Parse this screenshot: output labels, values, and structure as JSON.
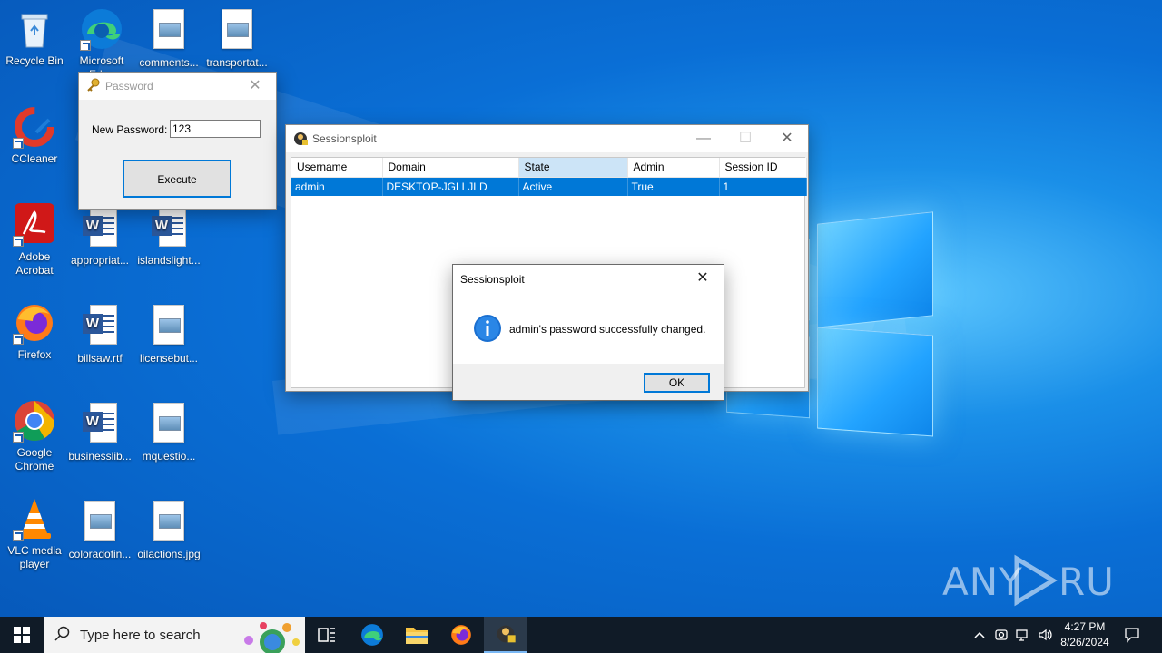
{
  "desktop": {
    "icons": [
      {
        "label": "Recycle Bin",
        "icon": "recycle-bin-icon"
      },
      {
        "label": "Microsoft Edge",
        "icon": "edge-icon"
      },
      {
        "label": "comments...",
        "icon": "image-file-icon"
      },
      {
        "label": "transportat...",
        "icon": "image-file-icon"
      },
      {
        "label": "CCleaner",
        "icon": "ccleaner-icon"
      },
      {
        "label": "Adobe Acrobat",
        "icon": "acrobat-icon"
      },
      {
        "label": "appropriat...",
        "icon": "word-doc-icon"
      },
      {
        "label": "islandslight...",
        "icon": "word-doc-icon"
      },
      {
        "label": "Firefox",
        "icon": "firefox-icon"
      },
      {
        "label": "billsaw.rtf",
        "icon": "word-doc-icon"
      },
      {
        "label": "licensebut...",
        "icon": "image-file-icon"
      },
      {
        "label": "Google Chrome",
        "icon": "chrome-icon"
      },
      {
        "label": "businesslib...",
        "icon": "word-doc-icon"
      },
      {
        "label": "mquestio...",
        "icon": "image-file-icon"
      },
      {
        "label": "VLC media player",
        "icon": "vlc-icon"
      },
      {
        "label": "coloradofin...",
        "icon": "image-file-icon"
      },
      {
        "label": "oilactions.jpg",
        "icon": "image-file-icon"
      }
    ]
  },
  "password_window": {
    "title": "Password",
    "field_label": "New Password:",
    "field_value": "123",
    "execute_label": "Execute"
  },
  "main_window": {
    "title": "Sessionsploit",
    "columns": [
      "Username",
      "Domain",
      "State",
      "Admin",
      "Session ID"
    ],
    "rows": [
      [
        "admin",
        "DESKTOP-JGLLJLD",
        "Active",
        "True",
        "1"
      ]
    ]
  },
  "dialog": {
    "title": "Sessionsploit",
    "message": "admin's password successfully changed.",
    "ok_label": "OK"
  },
  "taskbar": {
    "search_placeholder": "Type here to search",
    "time": "4:27 PM",
    "date": "8/26/2024"
  },
  "watermark": "ANY RUN",
  "colors": {
    "selection": "#0078d7",
    "taskbar": "#101b27",
    "info_icon": "#1a6fd0"
  }
}
